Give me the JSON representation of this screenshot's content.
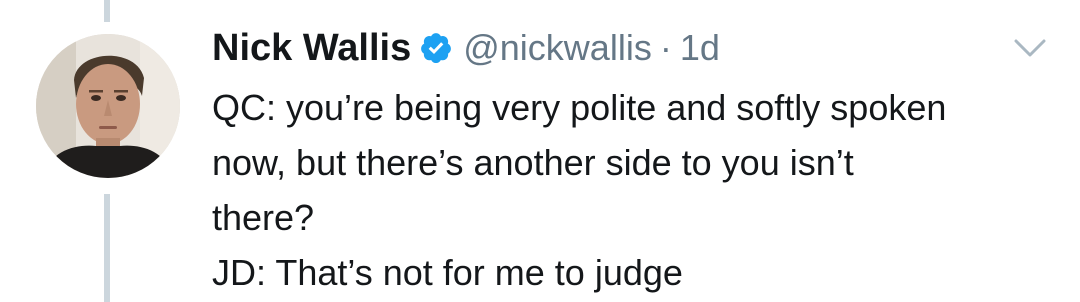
{
  "tweet": {
    "author_name": "Nick Wallis",
    "handle": "@nickwallis",
    "separator": "·",
    "timestamp": "1d",
    "lines": [
      "QC: you’re being very polite and softly spoken",
      "now, but there’s another side to you isn’t",
      "there?",
      "JD: That’s not for me to judge"
    ]
  },
  "icons": {
    "verified": "verified-badge-icon",
    "menu": "chevron-down-icon"
  },
  "colors": {
    "text": "#14171a",
    "secondary": "#657786",
    "verified_blue": "#1da1f2",
    "thread_line": "#ccd6dd"
  }
}
